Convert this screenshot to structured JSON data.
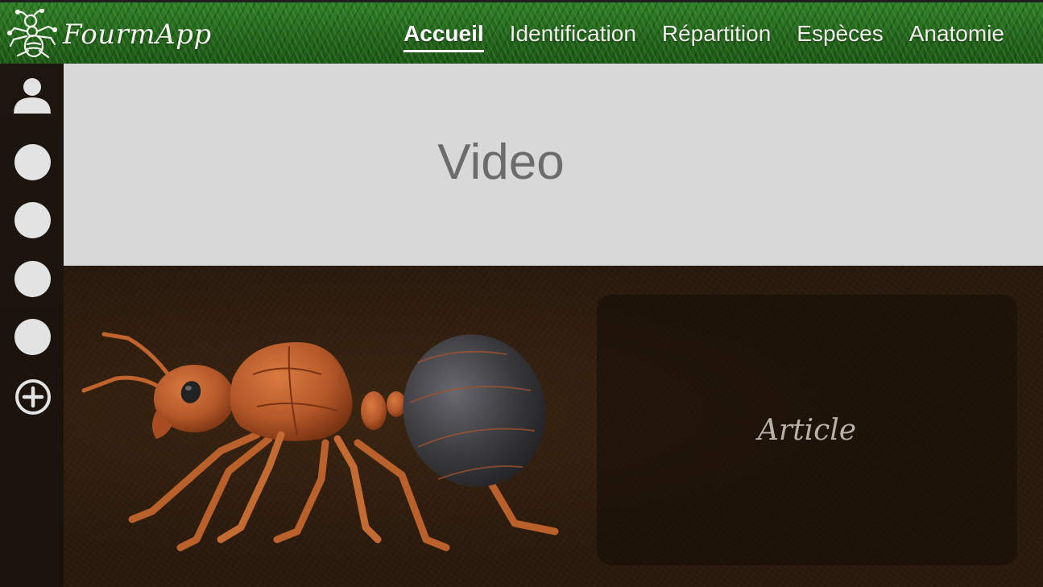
{
  "app": {
    "name": "FourmApp",
    "logo_icon": "ant-logo-icon"
  },
  "nav": {
    "items": [
      {
        "label": "Accueil",
        "active": true
      },
      {
        "label": "Identification",
        "active": false
      },
      {
        "label": "Répartition",
        "active": false
      },
      {
        "label": "Espèces",
        "active": false
      },
      {
        "label": "Anatomie",
        "active": false
      }
    ]
  },
  "sidebar": {
    "user_icon": "user-icon",
    "slots": 4,
    "add_icon": "plus-circle-icon"
  },
  "video": {
    "label": "Video"
  },
  "article": {
    "label": "Article"
  },
  "hero_image": {
    "icon": "ant-illustration"
  },
  "colors": {
    "topbar": "#22621c",
    "sidebar": "#1d150e",
    "video_bg": "#d8d8d8",
    "content_bg": "#2a1a0d",
    "ant_body": "#b5582a",
    "ant_gaster": "#3b3a3d"
  }
}
